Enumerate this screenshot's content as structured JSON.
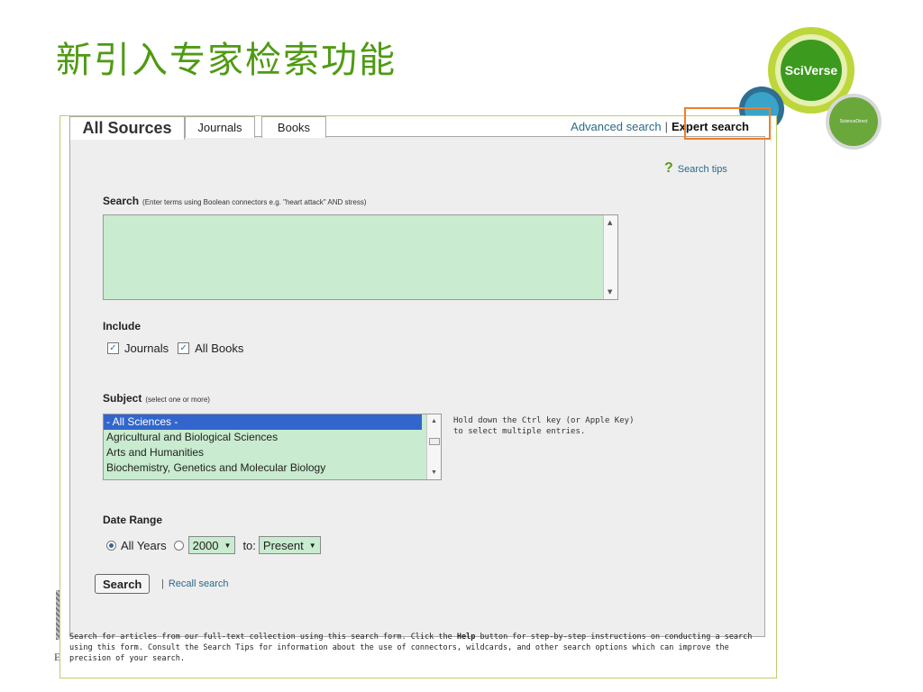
{
  "slide": {
    "title": "新引入专家检索功能"
  },
  "logos": {
    "sciverse": "SciVerse",
    "sciencedirect": "ScienceDirect",
    "publisher": "ELS"
  },
  "tabs": [
    {
      "label": "All Sources",
      "active": true
    },
    {
      "label": "Journals",
      "active": false
    },
    {
      "label": "Books",
      "active": false
    }
  ],
  "top_links": {
    "advanced": "Advanced search",
    "separator": "|",
    "expert": "Expert search"
  },
  "search_tips": {
    "icon": "?",
    "label": "Search tips"
  },
  "search": {
    "label": "Search",
    "hint": "(Enter terms using Boolean connectors e.g. \"heart attack\" AND stress)",
    "value": ""
  },
  "include": {
    "label": "Include",
    "options": [
      {
        "label": "Journals",
        "checked": true
      },
      {
        "label": "All Books",
        "checked": true
      }
    ]
  },
  "subject": {
    "label": "Subject",
    "hint": "(select one or more)",
    "options": [
      {
        "label": "- All Sciences -",
        "selected": true
      },
      {
        "label": "Agricultural and Biological Sciences",
        "selected": false
      },
      {
        "label": "Arts and Humanities",
        "selected": false
      },
      {
        "label": "Biochemistry, Genetics and Molecular Biology",
        "selected": false
      }
    ],
    "help_line1": "Hold down the Ctrl key (or Apple Key)",
    "help_line2": "to select multiple entries."
  },
  "date_range": {
    "label": "Date Range",
    "all_years": "All Years",
    "from_value": "2000",
    "to_label": "to:",
    "to_value": "Present",
    "all_years_selected": true
  },
  "actions": {
    "search_button": "Search",
    "separator": "|",
    "recall": "Recall search"
  },
  "footer": {
    "part1": "Search for articles from our full-text collection using this search form. Click the ",
    "help_word": "Help",
    "part2": " button for step-by-step instructions on conducting a search using this form. Consult the Search Tips for information about the use of connectors, wildcards, and other search options which can improve the precision of your search."
  },
  "colors": {
    "title": "#4f9a13",
    "field_bg": "#c9ebcf",
    "highlight": "#ee7e2a",
    "link": "#2a6a8a",
    "selected": "#3366cc"
  }
}
